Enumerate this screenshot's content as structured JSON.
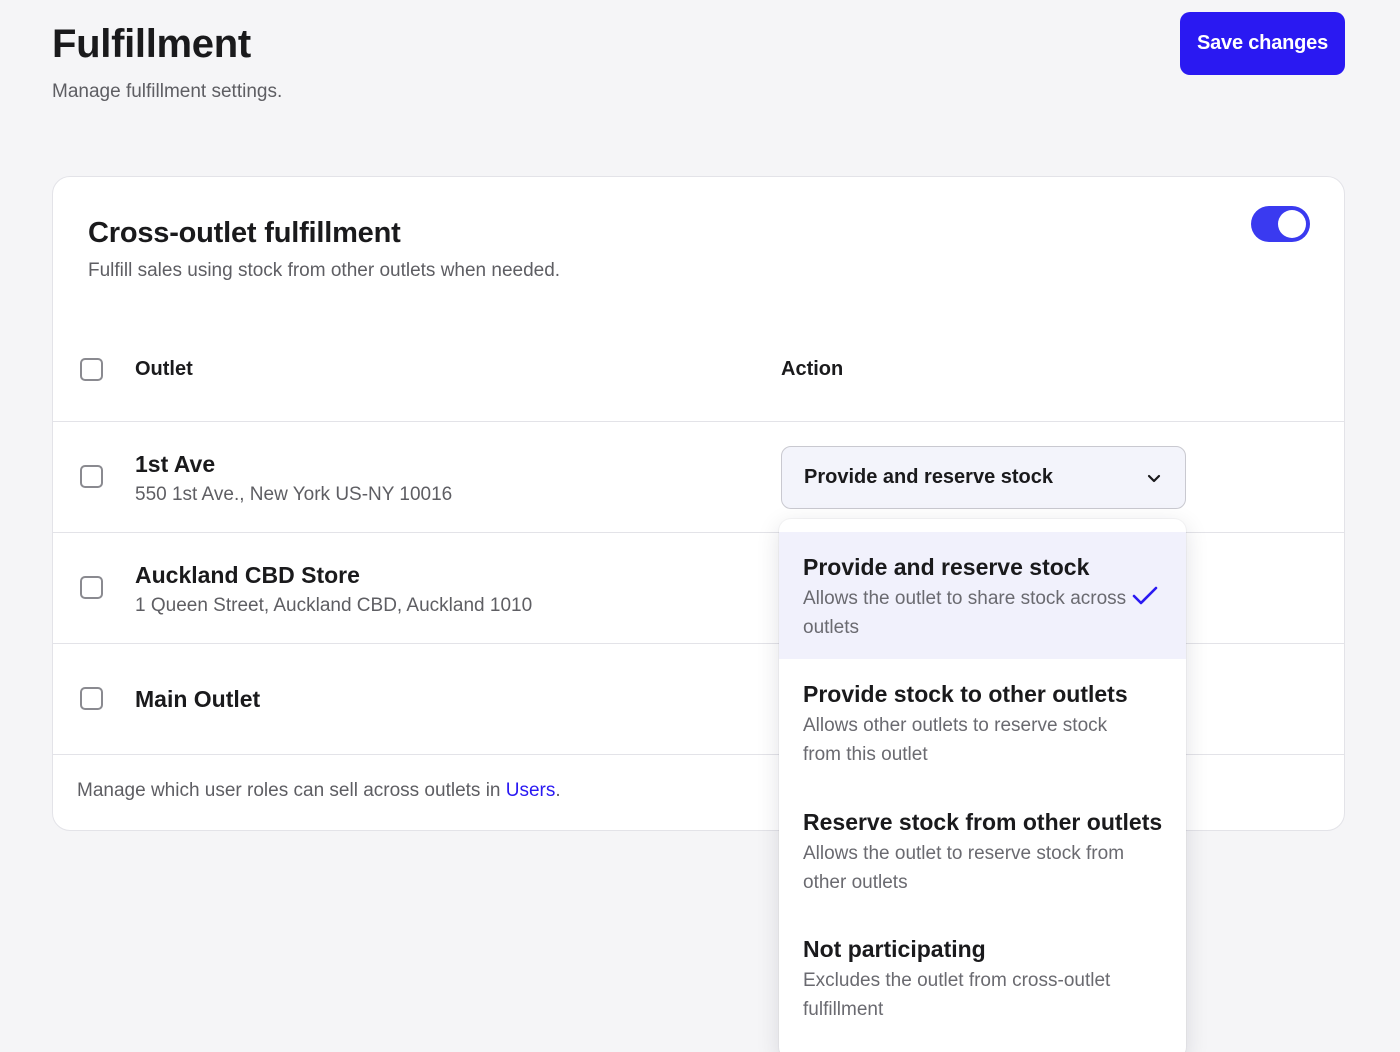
{
  "header": {
    "title": "Fulfillment",
    "subtitle": "Manage fulfillment settings.",
    "save_label": "Save changes"
  },
  "card": {
    "title": "Cross-outlet fulfillment",
    "subtitle": "Fulfill sales using stock from other outlets when needed.",
    "toggle_on": true
  },
  "table": {
    "columns": {
      "outlet": "Outlet",
      "action": "Action"
    },
    "rows": [
      {
        "name": "1st Ave",
        "address": "550 1st Ave., New York US-NY 10016",
        "action": "Provide and reserve stock"
      },
      {
        "name": "Auckland CBD Store",
        "address": "1 Queen Street, Auckland CBD, Auckland 1010"
      },
      {
        "name": "Main Outlet",
        "address": ""
      }
    ]
  },
  "footer": {
    "text_before": "Manage which user roles can sell across outlets in ",
    "link_label": "Users",
    "text_after": "."
  },
  "dropdown": {
    "selected_index": 0,
    "options": [
      {
        "title": "Provide and reserve stock",
        "description": "Allows the outlet to share stock across outlets"
      },
      {
        "title": "Provide stock to other outlets",
        "description": "Allows other outlets to reserve stock from this outlet"
      },
      {
        "title": "Reserve stock from other outlets",
        "description": "Allows the outlet to reserve stock from other outlets"
      },
      {
        "title": "Not participating",
        "description": "Excludes the outlet from cross-outlet fulfillment"
      }
    ]
  },
  "colors": {
    "accent": "#2a19f2",
    "toggle": "#3a3af0",
    "selected_option_bg": "#f1f1fc"
  }
}
